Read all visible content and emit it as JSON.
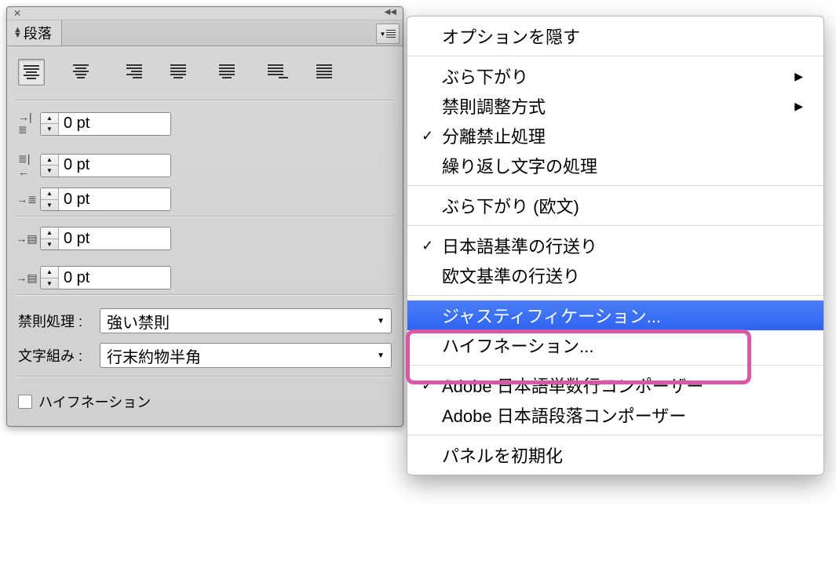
{
  "panel": {
    "title": "段落",
    "indentLeft": "0 pt",
    "indentRight": "0 pt",
    "indentFirst": "0 pt",
    "spaceBefore": "0 pt",
    "spaceAfter": "0 pt",
    "kinsokuLabel": "禁則処理 :",
    "kinsokuValue": "強い禁則",
    "mojikumiLabel": "文字組み :",
    "mojikumiValue": "行末約物半角",
    "hyphenationLabel": "ハイフネーション"
  },
  "menu": {
    "hideOptions": "オプションを隠す",
    "burasagari": "ぶら下がり",
    "kinsokuType": "禁則調整方式",
    "bunriKinshi": "分離禁止処理",
    "repeatChar": "繰り返し文字の処理",
    "burasagariRoman": "ぶら下がり (欧文)",
    "jpLeading": "日本語基準の行送り",
    "romanLeading": "欧文基準の行送り",
    "justification": "ジャスティフィケーション...",
    "hyphenation": "ハイフネーション...",
    "composerSingle": "Adobe 日本語単数行コンポーザー",
    "composerPara": "Adobe 日本語段落コンポーザー",
    "resetPanel": "パネルを初期化"
  }
}
